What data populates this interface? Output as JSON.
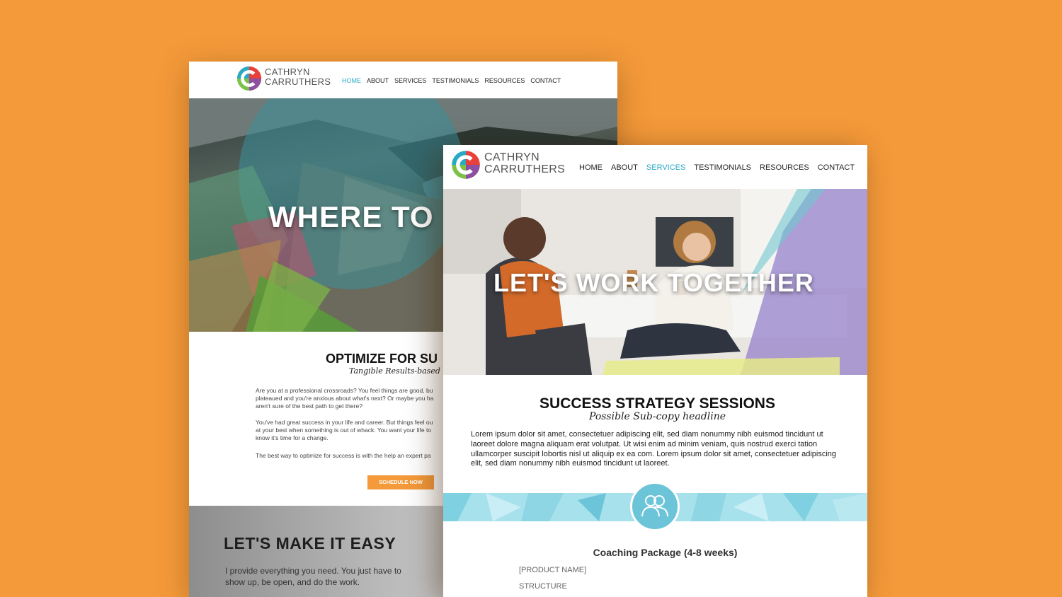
{
  "brand": {
    "line1": "CATHRYN",
    "line2": "CARRUTHERS"
  },
  "nav_home_page": {
    "items": [
      "HOME",
      "ABOUT",
      "SERVICES",
      "TESTIMONIALS",
      "RESOURCES",
      "CONTACT"
    ],
    "active": "HOME"
  },
  "nav_services_page": {
    "items": [
      "HOME",
      "ABOUT",
      "SERVICES",
      "TESTIMONIALS",
      "RESOURCES",
      "CONTACT"
    ],
    "active": "SERVICES"
  },
  "home": {
    "hero_title": "WHERE TO",
    "section_title": "OPTIMIZE FOR SU",
    "section_sub": "Tangible Results-based Coa",
    "para1": [
      "Are you at a professional crossroads? You feel things are good, bu",
      "plateaued and you're anxious about what's next? Or maybe you ha",
      "aren't sure of the best path to get there?"
    ],
    "para2": [
      "You've had great success in your life and career. But things feel ou",
      "at your best when something is out of whack. You want your life to",
      "know it's time for a change."
    ],
    "para3": "The best way to optimize for success is with the help an expert pa",
    "cta": "SCHEDULE NOW",
    "easy_title": "LET'S MAKE IT EASY",
    "easy_copy": "I provide everything you need. You just have to show up, be open, and do the work."
  },
  "services": {
    "hero_title": "LET'S WORK TOGETHER",
    "section_title": "SUCCESS STRATEGY SESSIONS",
    "section_sub": "Possible Sub-copy headline",
    "body": "Lorem ipsum dolor sit amet, consectetuer adipiscing elit, sed diam nonummy nibh euismod tincidunt ut laoreet dolore magna aliquam erat volutpat. Ut wisi enim ad minim veniam, quis nostrud exerci tation ullamcorper suscipit lobortis nisl ut aliquip ex ea com. Lorem ipsum dolor sit amet, consectetuer adipiscing elit, sed diam nonummy nibh euismod tincidunt ut laoreet.",
    "package_title": "Coaching Package (4-8 weeks)",
    "field1": "[PRODUCT NAME]",
    "field2": "STRUCTURE"
  },
  "colors": {
    "background": "#f49a3a",
    "accent": "#2aa8c6",
    "cta": "#f49a3a"
  },
  "icons": [
    "logo-c-icon",
    "people-icon"
  ]
}
